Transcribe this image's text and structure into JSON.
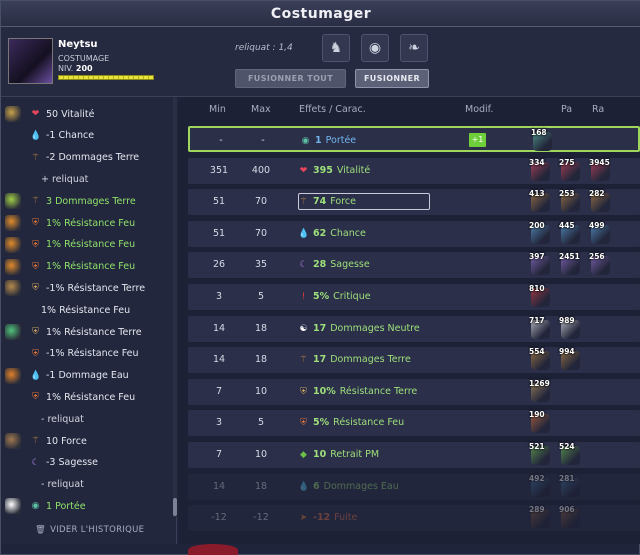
{
  "window": {
    "title": "Costumager"
  },
  "character": {
    "name": "Neytsu",
    "job": "COSTUMAGE",
    "level_label": "NIV.",
    "level": "200",
    "xp_fraction": 1.0
  },
  "header": {
    "reliquat": "reliquat : 1,4",
    "fuse_all_label": "FUSIONNER TOUT",
    "fuse_label": "FUSIONNER",
    "slots": [
      "costume-icon",
      "plate-icon",
      "feather-icon"
    ]
  },
  "history": {
    "clear_label": "VIDER L'HISTORIQUE",
    "lines": [
      {
        "icon": "heart-icon",
        "text": "50 Vitalité",
        "style": "normal",
        "indent": 1,
        "item": true
      },
      {
        "icon": "water-drop-icon",
        "text": "-1 Chance",
        "style": "normal",
        "indent": 1
      },
      {
        "icon": "earth-icon",
        "text": "-2 Dommages Terre",
        "style": "normal",
        "indent": 1
      },
      {
        "icon": "",
        "text": "+ reliquat",
        "style": "gray",
        "indent": 2
      },
      {
        "icon": "earth-icon",
        "text": "3 Dommages Terre",
        "style": "green",
        "indent": 1,
        "item": true
      },
      {
        "icon": "fire-shield-icon",
        "text": "1% Résistance Feu",
        "style": "green",
        "indent": 1,
        "item": true
      },
      {
        "icon": "fire-shield-icon",
        "text": "1% Résistance Feu",
        "style": "green",
        "indent": 1,
        "item": true
      },
      {
        "icon": "fire-shield-icon",
        "text": "1% Résistance Feu",
        "style": "green",
        "indent": 1,
        "item": true
      },
      {
        "icon": "earth-shield-icon",
        "text": "-1% Résistance Terre",
        "style": "normal",
        "indent": 1,
        "item": true
      },
      {
        "icon": "",
        "text": "1% Résistance Feu",
        "style": "normal",
        "indent": 2
      },
      {
        "icon": "earth-shield-icon",
        "text": "1% Résistance Terre",
        "style": "normal",
        "indent": 1,
        "item": true
      },
      {
        "icon": "fire-shield-icon",
        "text": "-1% Résistance Feu",
        "style": "normal",
        "indent": 1
      },
      {
        "icon": "water-drop-icon",
        "text": "-1 Dommage Eau",
        "style": "normal",
        "indent": 1,
        "item": true
      },
      {
        "icon": "fire-shield-icon",
        "text": "1% Résistance Feu",
        "style": "normal",
        "indent": 1
      },
      {
        "icon": "",
        "text": "- reliquat",
        "style": "gray",
        "indent": 2
      },
      {
        "icon": "earth-icon",
        "text": "10 Force",
        "style": "normal",
        "indent": 1,
        "item": true
      },
      {
        "icon": "moon-icon",
        "text": "-3 Sagesse",
        "style": "normal",
        "indent": 1
      },
      {
        "icon": "",
        "text": "- reliquat",
        "style": "gray",
        "indent": 2
      },
      {
        "icon": "eye-icon",
        "text": "1 Portée",
        "style": "green",
        "indent": 1,
        "item": true
      }
    ]
  },
  "table": {
    "headers": {
      "min": "Min",
      "max": "Max",
      "effects": "Effets / Carac.",
      "modif": "Modif.",
      "pa": "Pa",
      "ra": "Ra"
    },
    "rows": [
      {
        "min": "-",
        "max": "-",
        "icon": "eye-icon",
        "value": "1",
        "label": "Portée",
        "color": "blue",
        "modif": "+1",
        "selected": true,
        "runes": [
          "168"
        ]
      },
      {
        "min": "351",
        "max": "400",
        "icon": "heart-icon",
        "value": "395",
        "label": "Vitalité",
        "color": "green",
        "runes": [
          "334",
          "275",
          "3945"
        ]
      },
      {
        "min": "51",
        "max": "70",
        "icon": "earth-icon",
        "value": "74",
        "label": "Force",
        "color": "green",
        "boxed": true,
        "runes": [
          "413",
          "253",
          "282"
        ]
      },
      {
        "min": "51",
        "max": "70",
        "icon": "water-drop-icon",
        "value": "62",
        "label": "Chance",
        "color": "green",
        "runes": [
          "200",
          "445",
          "499"
        ]
      },
      {
        "min": "26",
        "max": "35",
        "icon": "moon-icon",
        "value": "28",
        "label": "Sagesse",
        "color": "green",
        "runes": [
          "397",
          "2451",
          "256"
        ]
      },
      {
        "min": "3",
        "max": "5",
        "icon": "exclamation-icon",
        "value": "5%",
        "label": "Critique",
        "color": "green",
        "runes": [
          "810"
        ]
      },
      {
        "min": "14",
        "max": "18",
        "icon": "yin-yang-icon",
        "value": "17",
        "label": "Dommages Neutre",
        "color": "green",
        "runes": [
          "717",
          "989"
        ]
      },
      {
        "min": "14",
        "max": "18",
        "icon": "earth-icon",
        "value": "17",
        "label": "Dommages Terre",
        "color": "green",
        "runes": [
          "554",
          "994"
        ]
      },
      {
        "min": "7",
        "max": "10",
        "icon": "earth-shield-icon",
        "value": "10%",
        "label": "Résistance Terre",
        "color": "green",
        "runes": [
          "1269"
        ]
      },
      {
        "min": "3",
        "max": "5",
        "icon": "fire-shield-icon",
        "value": "5%",
        "label": "Résistance Feu",
        "color": "green",
        "runes": [
          "190"
        ]
      },
      {
        "min": "7",
        "max": "10",
        "icon": "mp-icon",
        "value": "10",
        "label": "Retrait PM",
        "color": "green",
        "runes": [
          "521",
          "524"
        ]
      },
      {
        "min": "14",
        "max": "18",
        "icon": "water-drop-icon",
        "value": "6",
        "label": "Dommages Eau",
        "color": "green",
        "dim": true,
        "runes": [
          "492",
          "281"
        ]
      },
      {
        "min": "-12",
        "max": "-12",
        "icon": "dodge-icon",
        "value": "-12",
        "label": "Fuite",
        "color": "red",
        "dim": true,
        "runes": [
          "289",
          "906"
        ]
      }
    ]
  }
}
